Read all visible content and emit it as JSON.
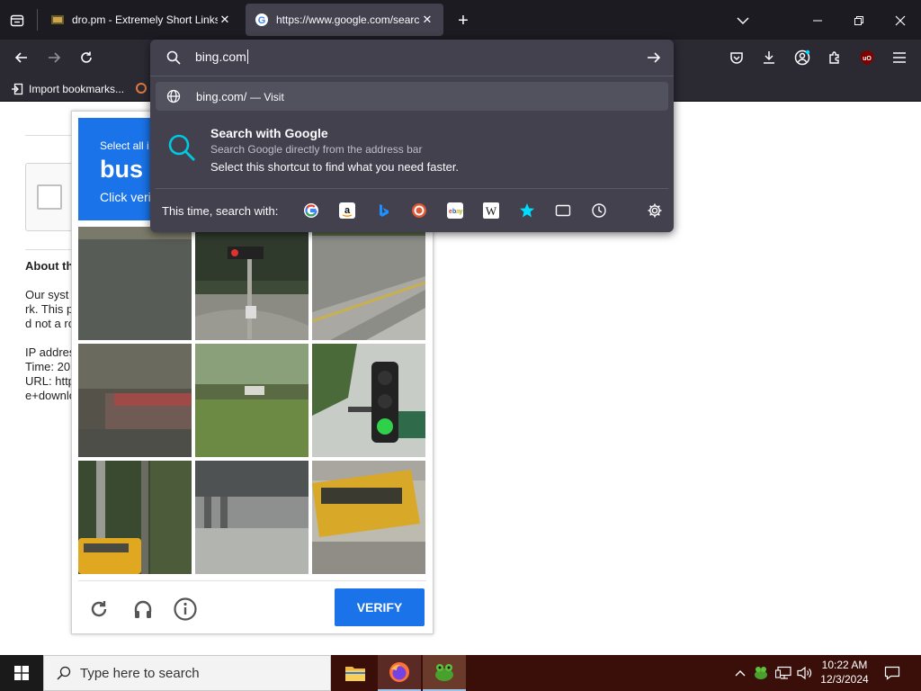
{
  "browser": {
    "tabs": [
      {
        "title": "dro.pm - Extremely Short Links",
        "active": false
      },
      {
        "title": "https://www.google.com/searc",
        "active": true
      }
    ],
    "new_tab": "+",
    "bookmarks": {
      "import_label": "Import bookmarks..."
    }
  },
  "urlbar": {
    "value": "bing.com",
    "suggestion_text": "bing.com/",
    "suggestion_action": "— Visit",
    "shortcut_title": "Search with Google",
    "shortcut_sub": "Search Google directly from the address bar",
    "shortcut_desc": "Select this shortcut to find what you need faster.",
    "search_with_label": "This time, search with:",
    "engines": [
      "google-icon",
      "amazon-icon",
      "bing-icon",
      "duckduckgo-icon",
      "ebay-icon",
      "wikipedia-icon",
      "bookmarks-star-icon",
      "tabs-icon",
      "history-icon"
    ]
  },
  "page": {
    "heading": "About th",
    "lines": [
      "Our syst",
      "rk. This p",
      "d not a ro",
      "",
      "IP addres",
      "Time: 20",
      "URL: http",
      "e+downlo"
    ]
  },
  "captcha": {
    "instruction_pre": "Select all i",
    "target": "bus",
    "instruction_post": "Click veri",
    "verify_label": "VERIFY",
    "accent": "#1a73e8"
  },
  "taskbar": {
    "search_placeholder": "Type here to search",
    "time": "10:22 AM",
    "date": "12/3/2024"
  }
}
